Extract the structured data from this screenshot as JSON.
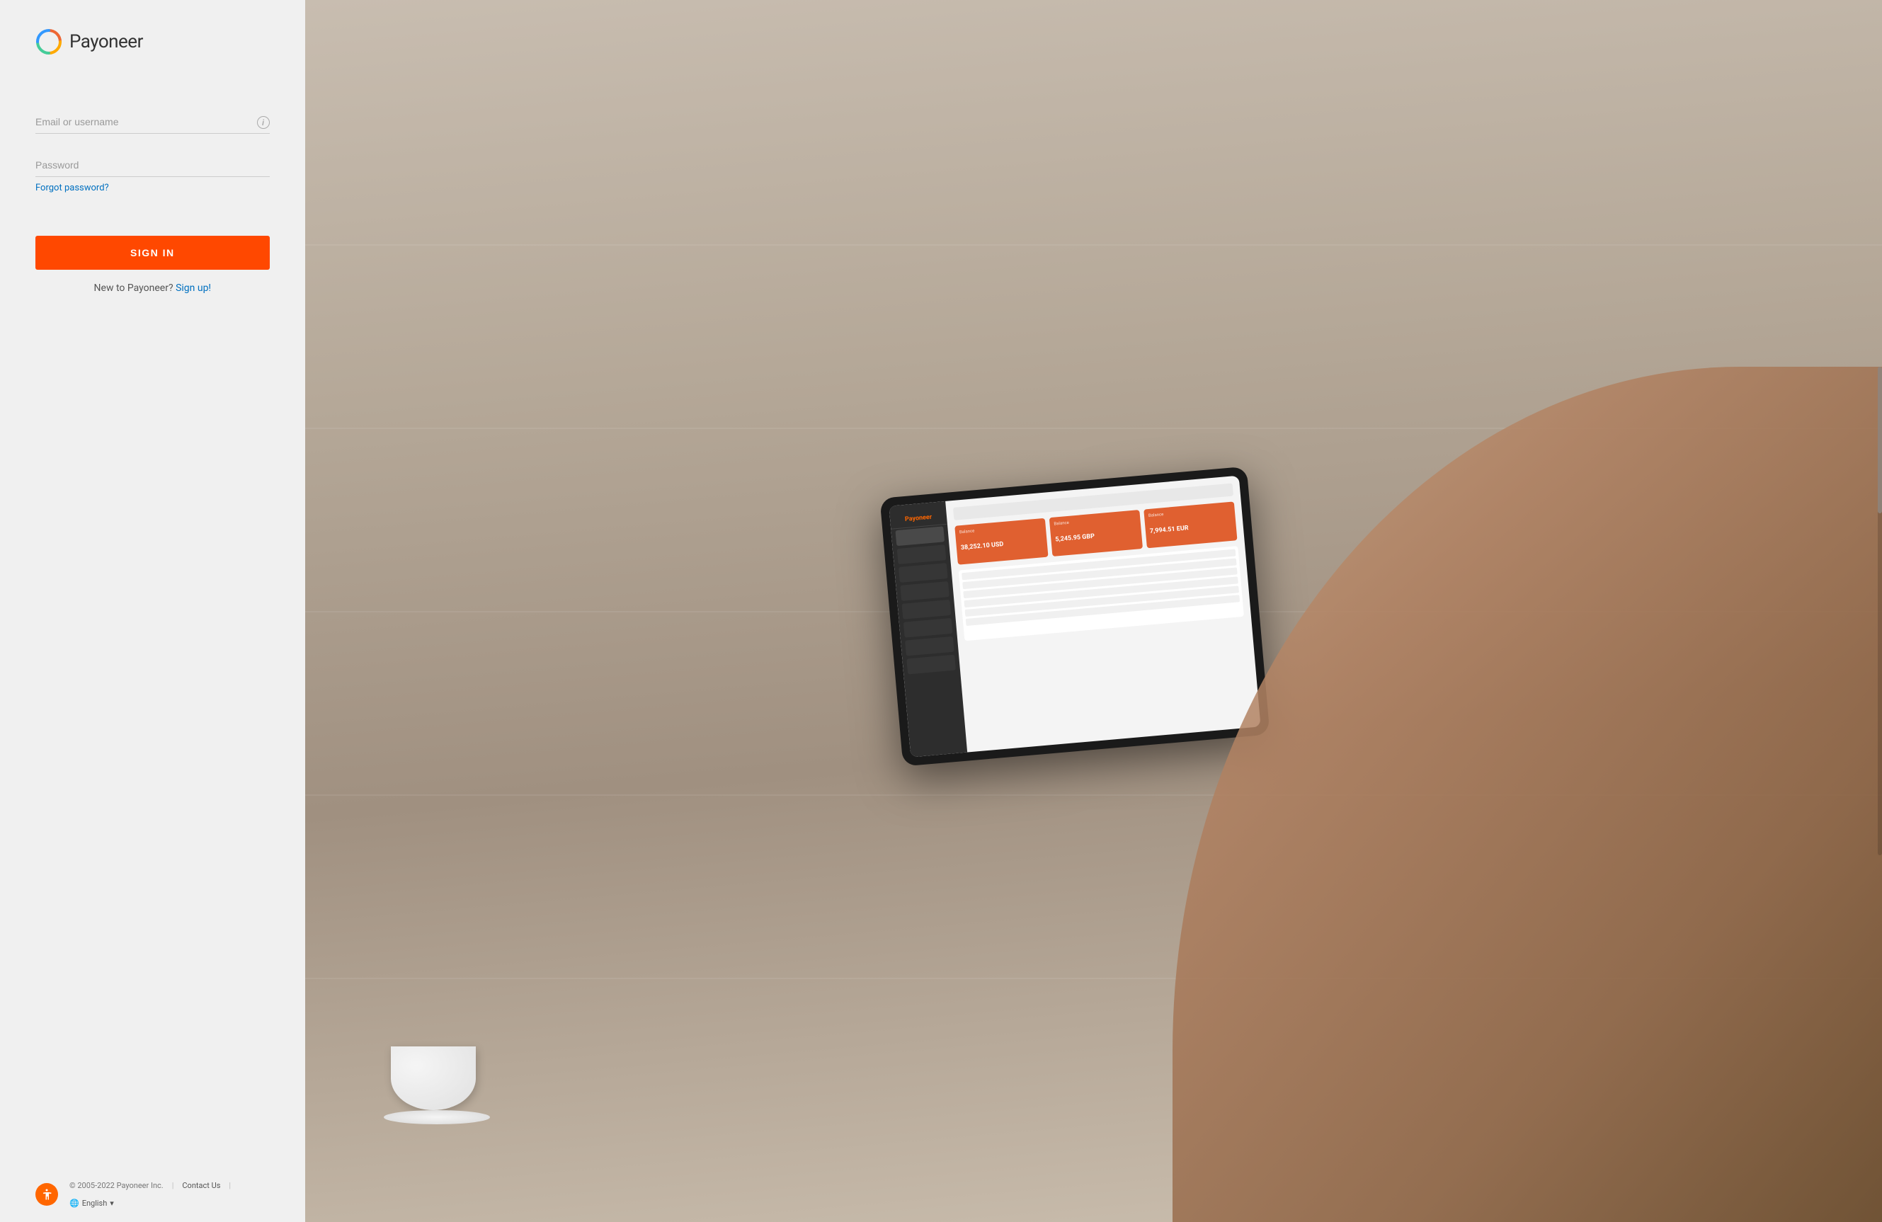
{
  "brand": {
    "logo_text": "Payoneer"
  },
  "form": {
    "email_placeholder": "Email or username",
    "password_placeholder": "Password",
    "forgot_password_label": "Forgot password?",
    "sign_in_label": "SIGN IN",
    "new_user_text": "New to Payoneer?",
    "signup_label": "Sign up!"
  },
  "footer": {
    "copyright": "© 2005-2022 Payoneer Inc.",
    "contact_label": "Contact Us",
    "language_label": "English"
  },
  "tablet": {
    "logo": "Payoneer",
    "card1_currency": "USD",
    "card1_amount": "38,252.10 USD",
    "card2_currency": "GBP",
    "card2_amount": "5,245.95 GBP",
    "card3_currency": "EUR",
    "card3_amount": "7,994.51 EUR"
  },
  "icons": {
    "info": "i",
    "globe": "🌐",
    "accessibility": "♿",
    "chevron_down": "▾"
  }
}
